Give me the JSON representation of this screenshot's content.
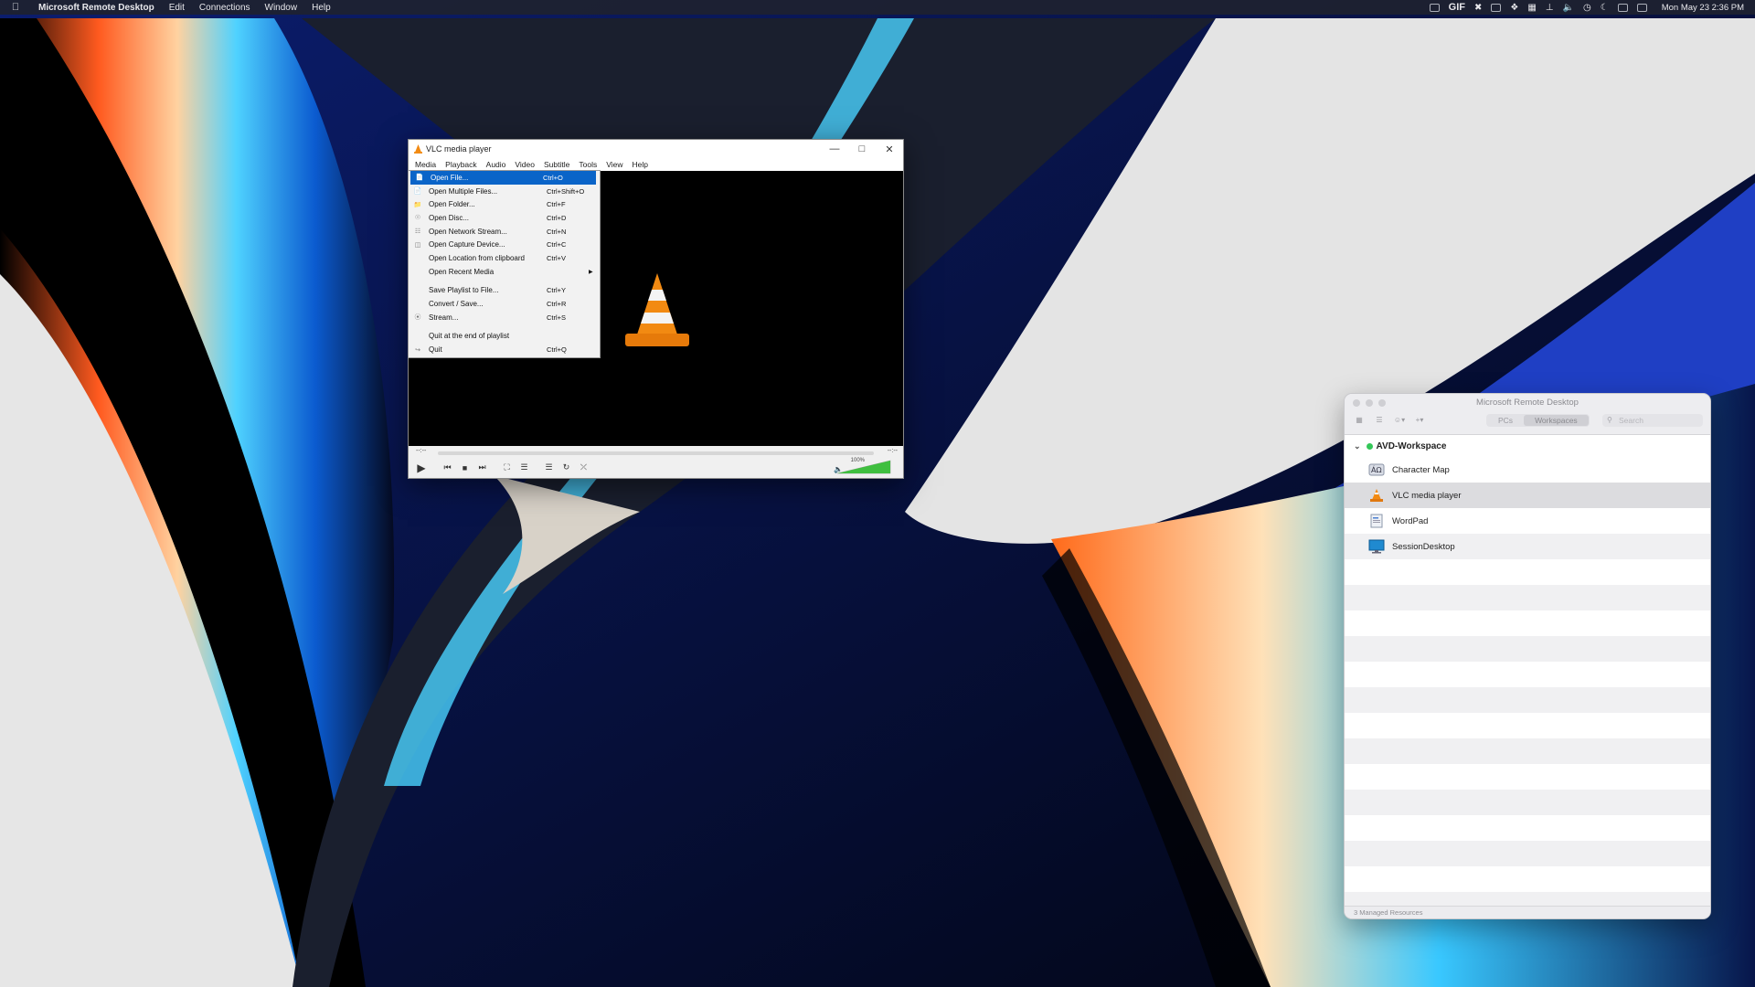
{
  "menubar": {
    "app_name": "Microsoft Remote Desktop",
    "items": [
      "Edit",
      "Connections",
      "Window",
      "Help"
    ],
    "gif_label": "GIF",
    "clock": "Mon May 23  2:36 PM"
  },
  "vlc": {
    "title": "VLC media player",
    "menus": [
      "Media",
      "Playback",
      "Audio",
      "Video",
      "Subtitle",
      "Tools",
      "View",
      "Help"
    ],
    "time_left": "--:--",
    "time_right": "--:--",
    "volume_label": "100%",
    "volume_level": 1.0
  },
  "media_menu": {
    "items": [
      {
        "label": "Open File...",
        "shortcut": "Ctrl+O",
        "icon": "file-icon",
        "highlighted": true
      },
      {
        "label": "Open Multiple Files...",
        "shortcut": "Ctrl+Shift+O",
        "icon": "files-icon"
      },
      {
        "label": "Open Folder...",
        "shortcut": "Ctrl+F",
        "icon": "folder-icon"
      },
      {
        "label": "Open Disc...",
        "shortcut": "Ctrl+D",
        "icon": "disc-icon"
      },
      {
        "label": "Open Network Stream...",
        "shortcut": "Ctrl+N",
        "icon": "network-icon"
      },
      {
        "label": "Open Capture Device...",
        "shortcut": "Ctrl+C",
        "icon": "capture-icon"
      },
      {
        "label": "Open Location from clipboard",
        "shortcut": "Ctrl+V",
        "icon": ""
      },
      {
        "label": "Open Recent Media",
        "shortcut": "",
        "icon": "",
        "submenu": true
      },
      {
        "separator": true
      },
      {
        "label": "Save Playlist to File...",
        "shortcut": "Ctrl+Y",
        "icon": ""
      },
      {
        "label": "Convert / Save...",
        "shortcut": "Ctrl+R",
        "icon": ""
      },
      {
        "label": "Stream...",
        "shortcut": "Ctrl+S",
        "icon": "stream-icon"
      },
      {
        "separator": true
      },
      {
        "label": "Quit at the end of playlist",
        "shortcut": "",
        "icon": ""
      },
      {
        "label": "Quit",
        "shortcut": "Ctrl+Q",
        "icon": "quit-icon"
      }
    ]
  },
  "mrd": {
    "title": "Microsoft Remote Desktop",
    "tab_pcs": "PCs",
    "tab_workspaces": "Workspaces",
    "search_placeholder": "Search",
    "workspace_name": "AVD-Workspace",
    "apps": [
      {
        "name": "Character Map",
        "icon": "character-map-icon"
      },
      {
        "name": "VLC media player",
        "icon": "vlc-icon",
        "selected": true
      },
      {
        "name": "WordPad",
        "icon": "wordpad-icon"
      },
      {
        "name": "SessionDesktop",
        "icon": "desktop-icon"
      }
    ],
    "status": "3 Managed Resources",
    "accent": "#34c759"
  }
}
